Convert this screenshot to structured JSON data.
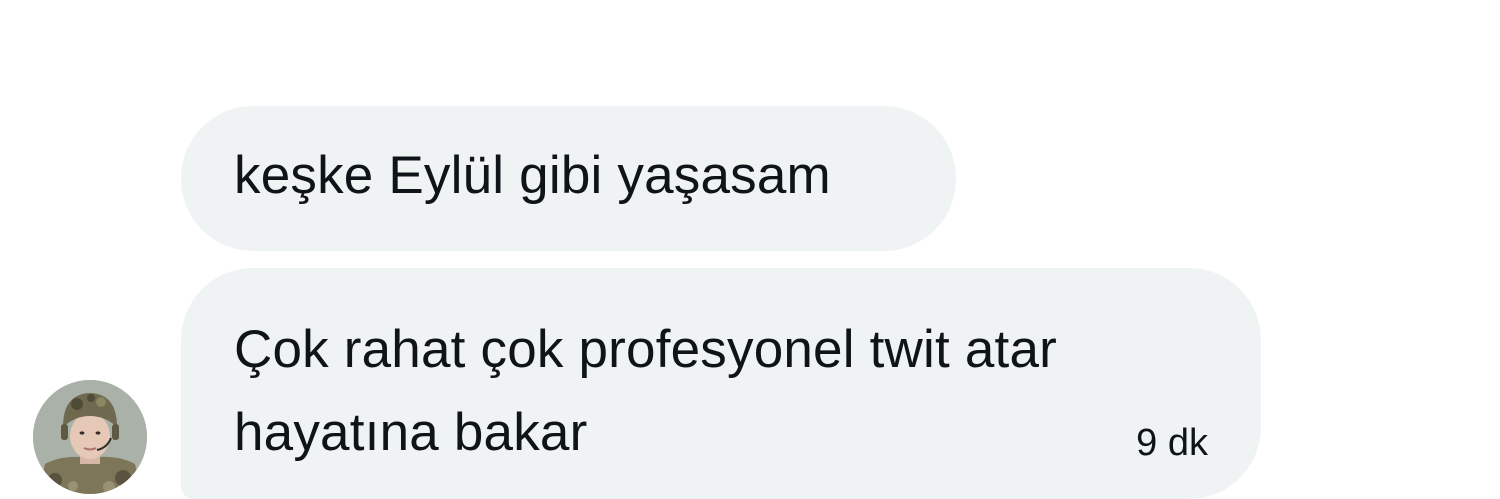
{
  "conversation": {
    "messages": [
      {
        "text": "keşke Eylül gibi yaşasam"
      },
      {
        "text": "Çok rahat çok profesyonel twit atar\nhayatına bakar",
        "timestamp": "9 dk"
      }
    ]
  },
  "colors": {
    "bubble_background": "#eff3f4",
    "text": "#0f1419",
    "page_background": "#ffffff"
  }
}
